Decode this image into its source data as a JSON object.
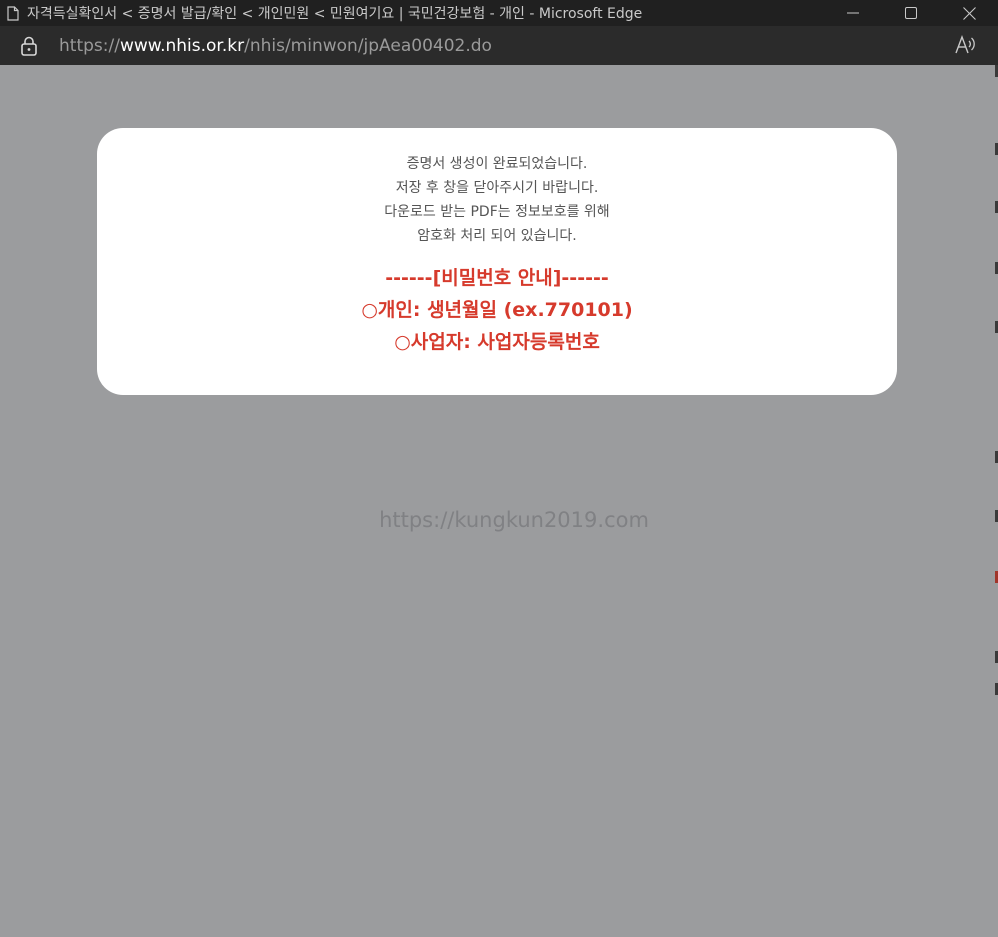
{
  "window": {
    "title": "자격득실확인서 < 증명서 발급/확인 < 개인민원 < 민원여기요 | 국민건강보험 - 개인 - Microsoft Edge"
  },
  "address": {
    "scheme": "https://",
    "host": "www.nhis.or.kr",
    "path": "/nhis/minwon/jpAea00402.do"
  },
  "icons": {
    "page": "document-icon",
    "lock": "lock-icon",
    "read_aloud": "read-aloud-icon",
    "minimize": "minimize-icon",
    "maximize": "maximize-icon",
    "close": "close-icon"
  },
  "modal": {
    "messages": [
      "증명서 생성이 완료되었습니다.",
      "저장 후 창을 닫아주시기 바랍니다.",
      "다운로드 받는 PDF는 정보보호를 위해",
      "암호화 처리 되어 있습니다."
    ],
    "password_header": "------[비밀번호 안내]------",
    "password_individual": "○개인: 생년월일 (ex.770101)",
    "password_business": "○사업자: 사업자등록번호"
  },
  "watermark": "https://kungkun2019.com",
  "colors": {
    "overlay": "#9b9c9e",
    "titlebar": "#202020",
    "addressbar": "#2b2b2b",
    "accent_red": "#d63a2c"
  }
}
